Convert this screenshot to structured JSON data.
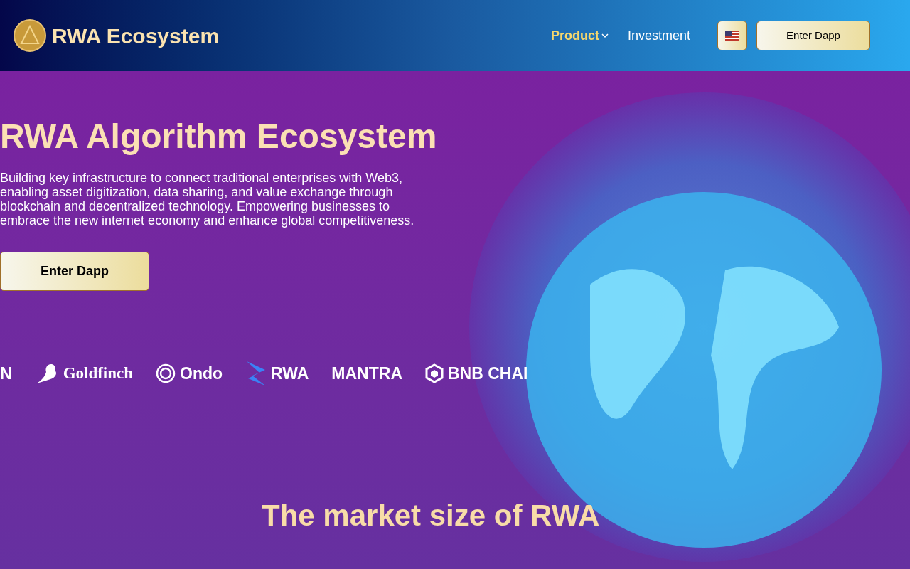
{
  "header": {
    "brand": "RWA Ecosystem",
    "nav": [
      {
        "label": "Product",
        "selected": true,
        "has_menu": true
      },
      {
        "label": "Investment",
        "selected": false,
        "has_menu": false
      }
    ],
    "cta": "Enter Dapp"
  },
  "hero": {
    "title": "RWA Algorithm Ecosystem",
    "description": "Building key infrastructure to connect traditional enterprises with Web3, enabling asset digitization, data sharing, and value exchange through blockchain and decentralized technology. Empowering businesses to embrace the new internet economy and enhance global competitiveness.",
    "cta": "Enter Dapp"
  },
  "partners": [
    {
      "kind": "plain",
      "name": "N"
    },
    {
      "kind": "bird",
      "name": "Goldfinch"
    },
    {
      "kind": "ring",
      "name": "Ondo"
    },
    {
      "kind": "bolt",
      "name": "RWA"
    },
    {
      "kind": "plain",
      "name": "MANTRA"
    },
    {
      "kind": "cube",
      "name": "BNB CHAI"
    }
  ],
  "section": {
    "title": "The market size of RWA"
  }
}
